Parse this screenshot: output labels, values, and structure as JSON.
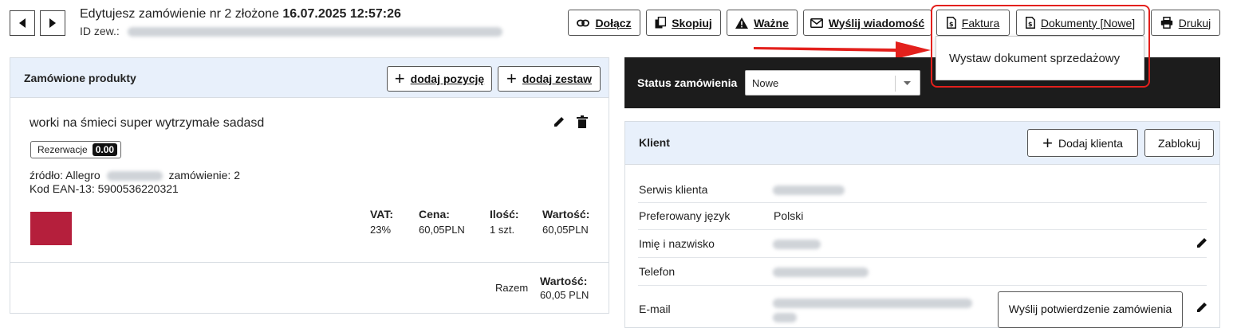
{
  "header": {
    "title_prefix": "Edytujesz zamówienie nr 2 złożone",
    "title_date": "16.07.2025 12:57:26",
    "external_id_label": "ID zew.:"
  },
  "toolbar": {
    "attach": "Dołącz",
    "copy": "Skopiuj",
    "important": "Ważne",
    "send_message": "Wyślij wiadomość",
    "invoice": "Faktura",
    "documents": "Dokumenty [Nowe]",
    "print": "Drukuj"
  },
  "documents_menu": {
    "items": [
      "Wystaw dokument sprzedażowy"
    ]
  },
  "products_panel": {
    "title": "Zamówione produkty",
    "add_item": "dodaj pozycję",
    "add_set": "dodaj zestaw",
    "product": {
      "name": "worki na śmieci super wytrzymałe sadasd",
      "reservation_label": "Rezerwacje",
      "reservation_value": "0.00",
      "source_label": "źródło: Allegro",
      "order_label": "zamówienie: 2",
      "ean": "Kod EAN-13: 5900536220321",
      "thumbnail_color": "#b51f3c",
      "vat_label": "VAT:",
      "vat_value": "23%",
      "price_label": "Cena:",
      "price_value": "60,05PLN",
      "qty_label": "Ilość:",
      "qty_value": "1 szt.",
      "value_label": "Wartość:",
      "value_value": "60,05PLN"
    },
    "total": {
      "label": "Razem",
      "value_label": "Wartość:",
      "value": "60,05 PLN"
    }
  },
  "status": {
    "label": "Status zamówienia",
    "selected": "Nowe"
  },
  "client_panel": {
    "title": "Klient",
    "add_client": "Dodaj klienta",
    "block": "Zablokuj",
    "rows": {
      "service": "Serwis klienta",
      "language_label": "Preferowany język",
      "language_value": "Polski",
      "name": "Imię i nazwisko",
      "phone": "Telefon",
      "email": "E-mail"
    },
    "send_confirmation": "Wyślij potwierdzenie zamówienia"
  },
  "colors": {
    "accent_header_bg": "#e8f0fb",
    "highlight_red": "#e3201c",
    "status_bar_bg": "#1c1c1c"
  }
}
